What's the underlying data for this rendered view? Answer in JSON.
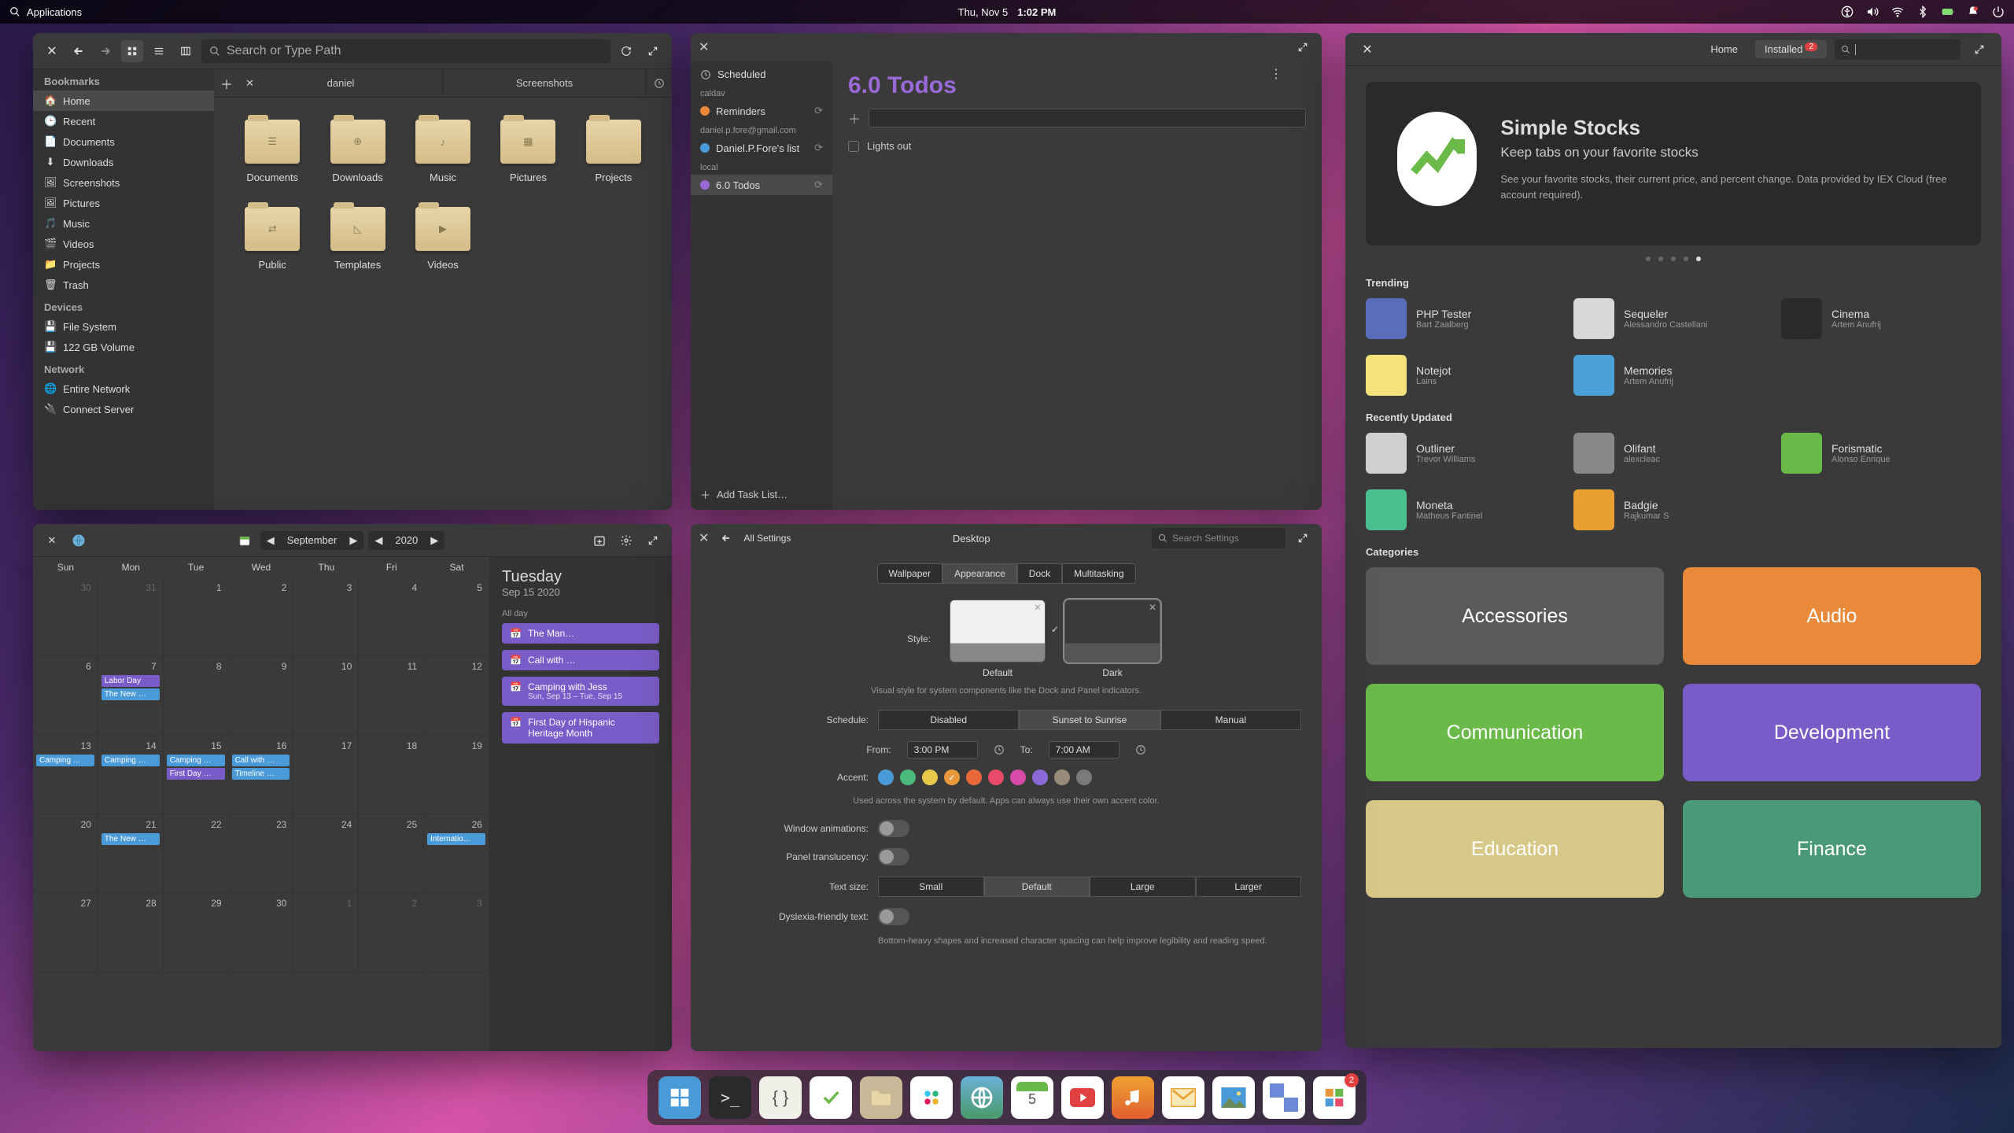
{
  "panel": {
    "applications": "Applications",
    "date": "Thu, Nov  5",
    "time": "1:02 PM"
  },
  "files": {
    "search_placeholder": "Search or Type Path",
    "tabs": [
      "daniel",
      "Screenshots"
    ],
    "sidebar": {
      "bookmarks_hdr": "Bookmarks",
      "bookmarks": [
        "Home",
        "Recent",
        "Documents",
        "Downloads",
        "Screenshots",
        "Pictures",
        "Music",
        "Videos",
        "Projects",
        "Trash"
      ],
      "devices_hdr": "Devices",
      "devices": [
        "File System",
        "122 GB Volume"
      ],
      "network_hdr": "Network",
      "network": [
        "Entire Network",
        "Connect Server"
      ]
    },
    "folders": [
      "Documents",
      "Downloads",
      "Music",
      "Pictures",
      "Projects",
      "Public",
      "Templates",
      "Videos"
    ]
  },
  "tasks": {
    "scheduled": "Scheduled",
    "caldav_hdr": "caldav",
    "reminders": "Reminders",
    "gmail_hdr": "daniel.p.fore@gmail.com",
    "gmail_list": "Daniel.P.Fore's list",
    "local_hdr": "local",
    "local_list": "6.0 Todos",
    "add_list": "Add Task List…",
    "title": "6.0 Todos",
    "items": [
      "Lights out"
    ]
  },
  "apps": {
    "home": "Home",
    "installed": "Installed",
    "installed_badge": "2",
    "hero": {
      "title": "Simple Stocks",
      "subtitle": "Keep tabs on your favorite stocks",
      "desc": "See your favorite stocks, their current price, and percent change. Data provided by IEX Cloud (free account required)."
    },
    "trending_hdr": "Trending",
    "trending": [
      {
        "name": "PHP Tester",
        "author": "Bart Zaalberg",
        "bg": "#5a6db8"
      },
      {
        "name": "Sequeler",
        "author": "Alessandro Castellani",
        "bg": "#d8d8d8"
      },
      {
        "name": "Cinema",
        "author": "Artem Anufrij",
        "bg": "#2a2a2a"
      },
      {
        "name": "Notejot",
        "author": "Lains",
        "bg": "#f5e27a"
      },
      {
        "name": "Memories",
        "author": "Artem Anufrij",
        "bg": "#4aa0d8"
      }
    ],
    "updated_hdr": "Recently Updated",
    "updated": [
      {
        "name": "Outliner",
        "author": "Trevor Williams",
        "bg": "#d0d0d0"
      },
      {
        "name": "Olifant",
        "author": "alexcleac",
        "bg": "#888"
      },
      {
        "name": "Forismatic",
        "author": "Alonso Enrique",
        "bg": "#6aba4a"
      },
      {
        "name": "Moneta",
        "author": "Matheus Fantinel",
        "bg": "#4ac090"
      },
      {
        "name": "Badgie",
        "author": "Rajkumar S",
        "bg": "#e8a030"
      }
    ],
    "categories_hdr": "Categories",
    "categories": [
      {
        "name": "Accessories",
        "bg": "#5a5a5a"
      },
      {
        "name": "Audio",
        "bg": "#e88a3a"
      },
      {
        "name": "Communication",
        "bg": "#6aba4a"
      },
      {
        "name": "Development",
        "bg": "#7a5cc8"
      },
      {
        "name": "Education",
        "bg": "#d8c888"
      },
      {
        "name": "Finance",
        "bg": "#4a9a7a"
      }
    ]
  },
  "cal": {
    "month": "September",
    "year": "2020",
    "dow": [
      "Sun",
      "Mon",
      "Tue",
      "Wed",
      "Thu",
      "Fri",
      "Sat"
    ],
    "side": {
      "day": "Tuesday",
      "date": "Sep 15 2020",
      "allday": "All day",
      "events": [
        {
          "title": "The Man…"
        },
        {
          "title": "Call with …"
        },
        {
          "title": "Camping with Jess",
          "sub": "Sun, Sep 13 – Tue, Sep 15"
        },
        {
          "title": "First Day of Hispanic Heritage Month"
        }
      ]
    },
    "cells": [
      {
        "n": "30",
        "dim": true
      },
      {
        "n": "31",
        "dim": true
      },
      {
        "n": "1"
      },
      {
        "n": "2"
      },
      {
        "n": "3"
      },
      {
        "n": "4"
      },
      {
        "n": "5"
      },
      {
        "n": "6"
      },
      {
        "n": "7",
        "ev": [
          {
            "t": "Labor Day",
            "c": "#7a5cc8"
          },
          {
            "t": "The New …",
            "c": "#4a9ad8"
          }
        ]
      },
      {
        "n": "8"
      },
      {
        "n": "9"
      },
      {
        "n": "10"
      },
      {
        "n": "11"
      },
      {
        "n": "12"
      },
      {
        "n": "13",
        "ev": [
          {
            "t": "Camping …",
            "c": "#4a9ad8"
          }
        ]
      },
      {
        "n": "14",
        "ev": [
          {
            "t": "Camping …",
            "c": "#4a9ad8"
          }
        ]
      },
      {
        "n": "15",
        "ev": [
          {
            "t": "Camping …",
            "c": "#4a9ad8"
          },
          {
            "t": "First Day …",
            "c": "#7a5cc8"
          }
        ]
      },
      {
        "n": "16",
        "ev": [
          {
            "t": "Call with …",
            "c": "#4a9ad8"
          },
          {
            "t": "Timeline …",
            "c": "#4a9ad8"
          }
        ]
      },
      {
        "n": "17"
      },
      {
        "n": "18"
      },
      {
        "n": "19"
      },
      {
        "n": "20"
      },
      {
        "n": "21",
        "ev": [
          {
            "t": "The New …",
            "c": "#4a9ad8"
          }
        ]
      },
      {
        "n": "22"
      },
      {
        "n": "23"
      },
      {
        "n": "24"
      },
      {
        "n": "25"
      },
      {
        "n": "26",
        "ev": [
          {
            "t": "Internatio…",
            "c": "#4a9ad8"
          }
        ]
      },
      {
        "n": "27"
      },
      {
        "n": "28"
      },
      {
        "n": "29"
      },
      {
        "n": "30"
      },
      {
        "n": "1",
        "dim": true
      },
      {
        "n": "2",
        "dim": true
      },
      {
        "n": "3",
        "dim": true
      }
    ]
  },
  "settings": {
    "all": "All Settings",
    "title": "Desktop",
    "search_placeholder": "Search Settings",
    "tabs": [
      "Wallpaper",
      "Appearance",
      "Dock",
      "Multitasking"
    ],
    "style_lbl": "Style:",
    "style_default": "Default",
    "style_dark": "Dark",
    "style_hint": "Visual style for system components like the Dock and Panel indicators.",
    "schedule_lbl": "Schedule:",
    "schedule": [
      "Disabled",
      "Sunset to Sunrise",
      "Manual"
    ],
    "from_lbl": "From:",
    "from_val": "3:00 PM",
    "to_lbl": "To:",
    "to_val": "7:00 AM",
    "accent_lbl": "Accent:",
    "accent_hint": "Used across the system by default. Apps can always use their own accent color.",
    "anim_lbl": "Window animations:",
    "trans_lbl": "Panel translucency:",
    "text_lbl": "Text size:",
    "text_opts": [
      "Small",
      "Default",
      "Large",
      "Larger"
    ],
    "dys_lbl": "Dyslexia-friendly text:",
    "dys_hint": "Bottom-heavy shapes and increased character spacing can help improve legibility and reading speed.",
    "accents": [
      "#4a9ad8",
      "#4aba7a",
      "#e8c84a",
      "#e8983a",
      "#e8683a",
      "#e84a6a",
      "#d84aa8",
      "#8a6ad8",
      "#9a8a7a",
      "#7a7a7a"
    ]
  },
  "dock_badge": "2"
}
